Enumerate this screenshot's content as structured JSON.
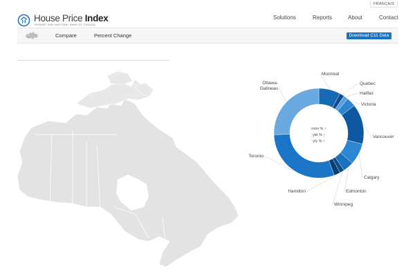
{
  "header": {
    "language_link": "FRANÇAIS",
    "logo": {
      "title_light": "House Price ",
      "title_bold": "Index",
      "tagline": "TERANET AND NATIONAL BANK OF CANADA"
    },
    "nav": [
      "Solutions",
      "Reports",
      "About",
      "Contact"
    ]
  },
  "subnav": {
    "tabs": [
      "Compare",
      "Percent Change"
    ],
    "download_label": "Download C11 Data"
  },
  "ring_chart": {
    "center_lines": [
      "m/m % ↑",
      "ytd % ↑",
      "y/y % ↑"
    ],
    "segments": [
      {
        "label": "Montreal",
        "color": "#1669b3"
      },
      {
        "label": "Quebec",
        "color": "#0d4c88"
      },
      {
        "label": "Halifax",
        "color": "#5aa1dc"
      },
      {
        "label": "Victoria",
        "color": "#2c87d2"
      },
      {
        "label": "Vancouver",
        "color": "#0d58a0"
      },
      {
        "label": "Calgary",
        "color": "#2c87d2"
      },
      {
        "label": "Edmonton",
        "color": "#1a71bf"
      },
      {
        "label": "Winnipeg",
        "color": "#0d4c88"
      },
      {
        "label": "Hamilton",
        "color": "#0a3f73"
      },
      {
        "label": "Toronto",
        "color": "#1b75c7"
      },
      {
        "label": "Ottawa-Gatineau",
        "color": "#6aa9df"
      }
    ]
  },
  "colors": {
    "accent": "#1b72c0",
    "map_fill": "#e6e6e6",
    "map_border": "#ffffff"
  }
}
